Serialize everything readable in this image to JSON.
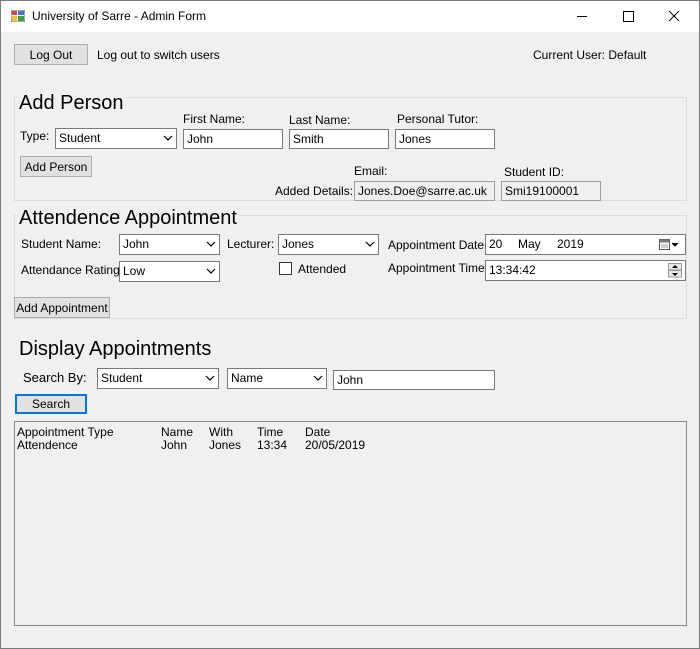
{
  "window": {
    "title": "University of Sarre - Admin Form"
  },
  "top_bar": {
    "logout_label": "Log Out",
    "logout_hint": "Log out to switch users",
    "current_user": "Current User: Default"
  },
  "add_person": {
    "title": "Add Person",
    "type_label": "Type:",
    "type_value": "Student",
    "first_name_label": "First Name:",
    "first_name_value": "John",
    "last_name_label": "Last Name:",
    "last_name_value": "Smith",
    "tutor_label": "Personal Tutor:",
    "tutor_value": "Jones",
    "add_button": "Add Person",
    "added_details_label": "Added Details:",
    "email_label": "Email:",
    "email_value": "Jones.Doe@sarre.ac.uk",
    "student_id_label": "Student ID:",
    "student_id_value": "Smi19100001"
  },
  "appointment": {
    "title": "Attendence Appointment",
    "student_name_label": "Student Name:",
    "student_name_value": "John",
    "lecturer_label": "Lecturer:",
    "lecturer_value": "Jones",
    "date_label": "Appointment Date:",
    "date_day": "20",
    "date_month": "May",
    "date_year": "2019",
    "rating_label": "Attendance Rating",
    "rating_value": "Low",
    "attended_label": "Attended",
    "attended_checked": false,
    "time_label": "Appointment Time:",
    "time_value": "13:34:42",
    "add_button": "Add Appointment"
  },
  "display": {
    "title": "Display Appointments",
    "search_by_label": "Search By:",
    "search_by_value": "Student",
    "field_value": "Name",
    "query_value": "John",
    "search_button": "Search",
    "columns": [
      "Appointment Type",
      "Name",
      "With",
      "Time",
      "Date"
    ],
    "rows": [
      [
        "Attendence",
        "John",
        "Jones",
        "13:34",
        "20/05/2019"
      ]
    ]
  }
}
